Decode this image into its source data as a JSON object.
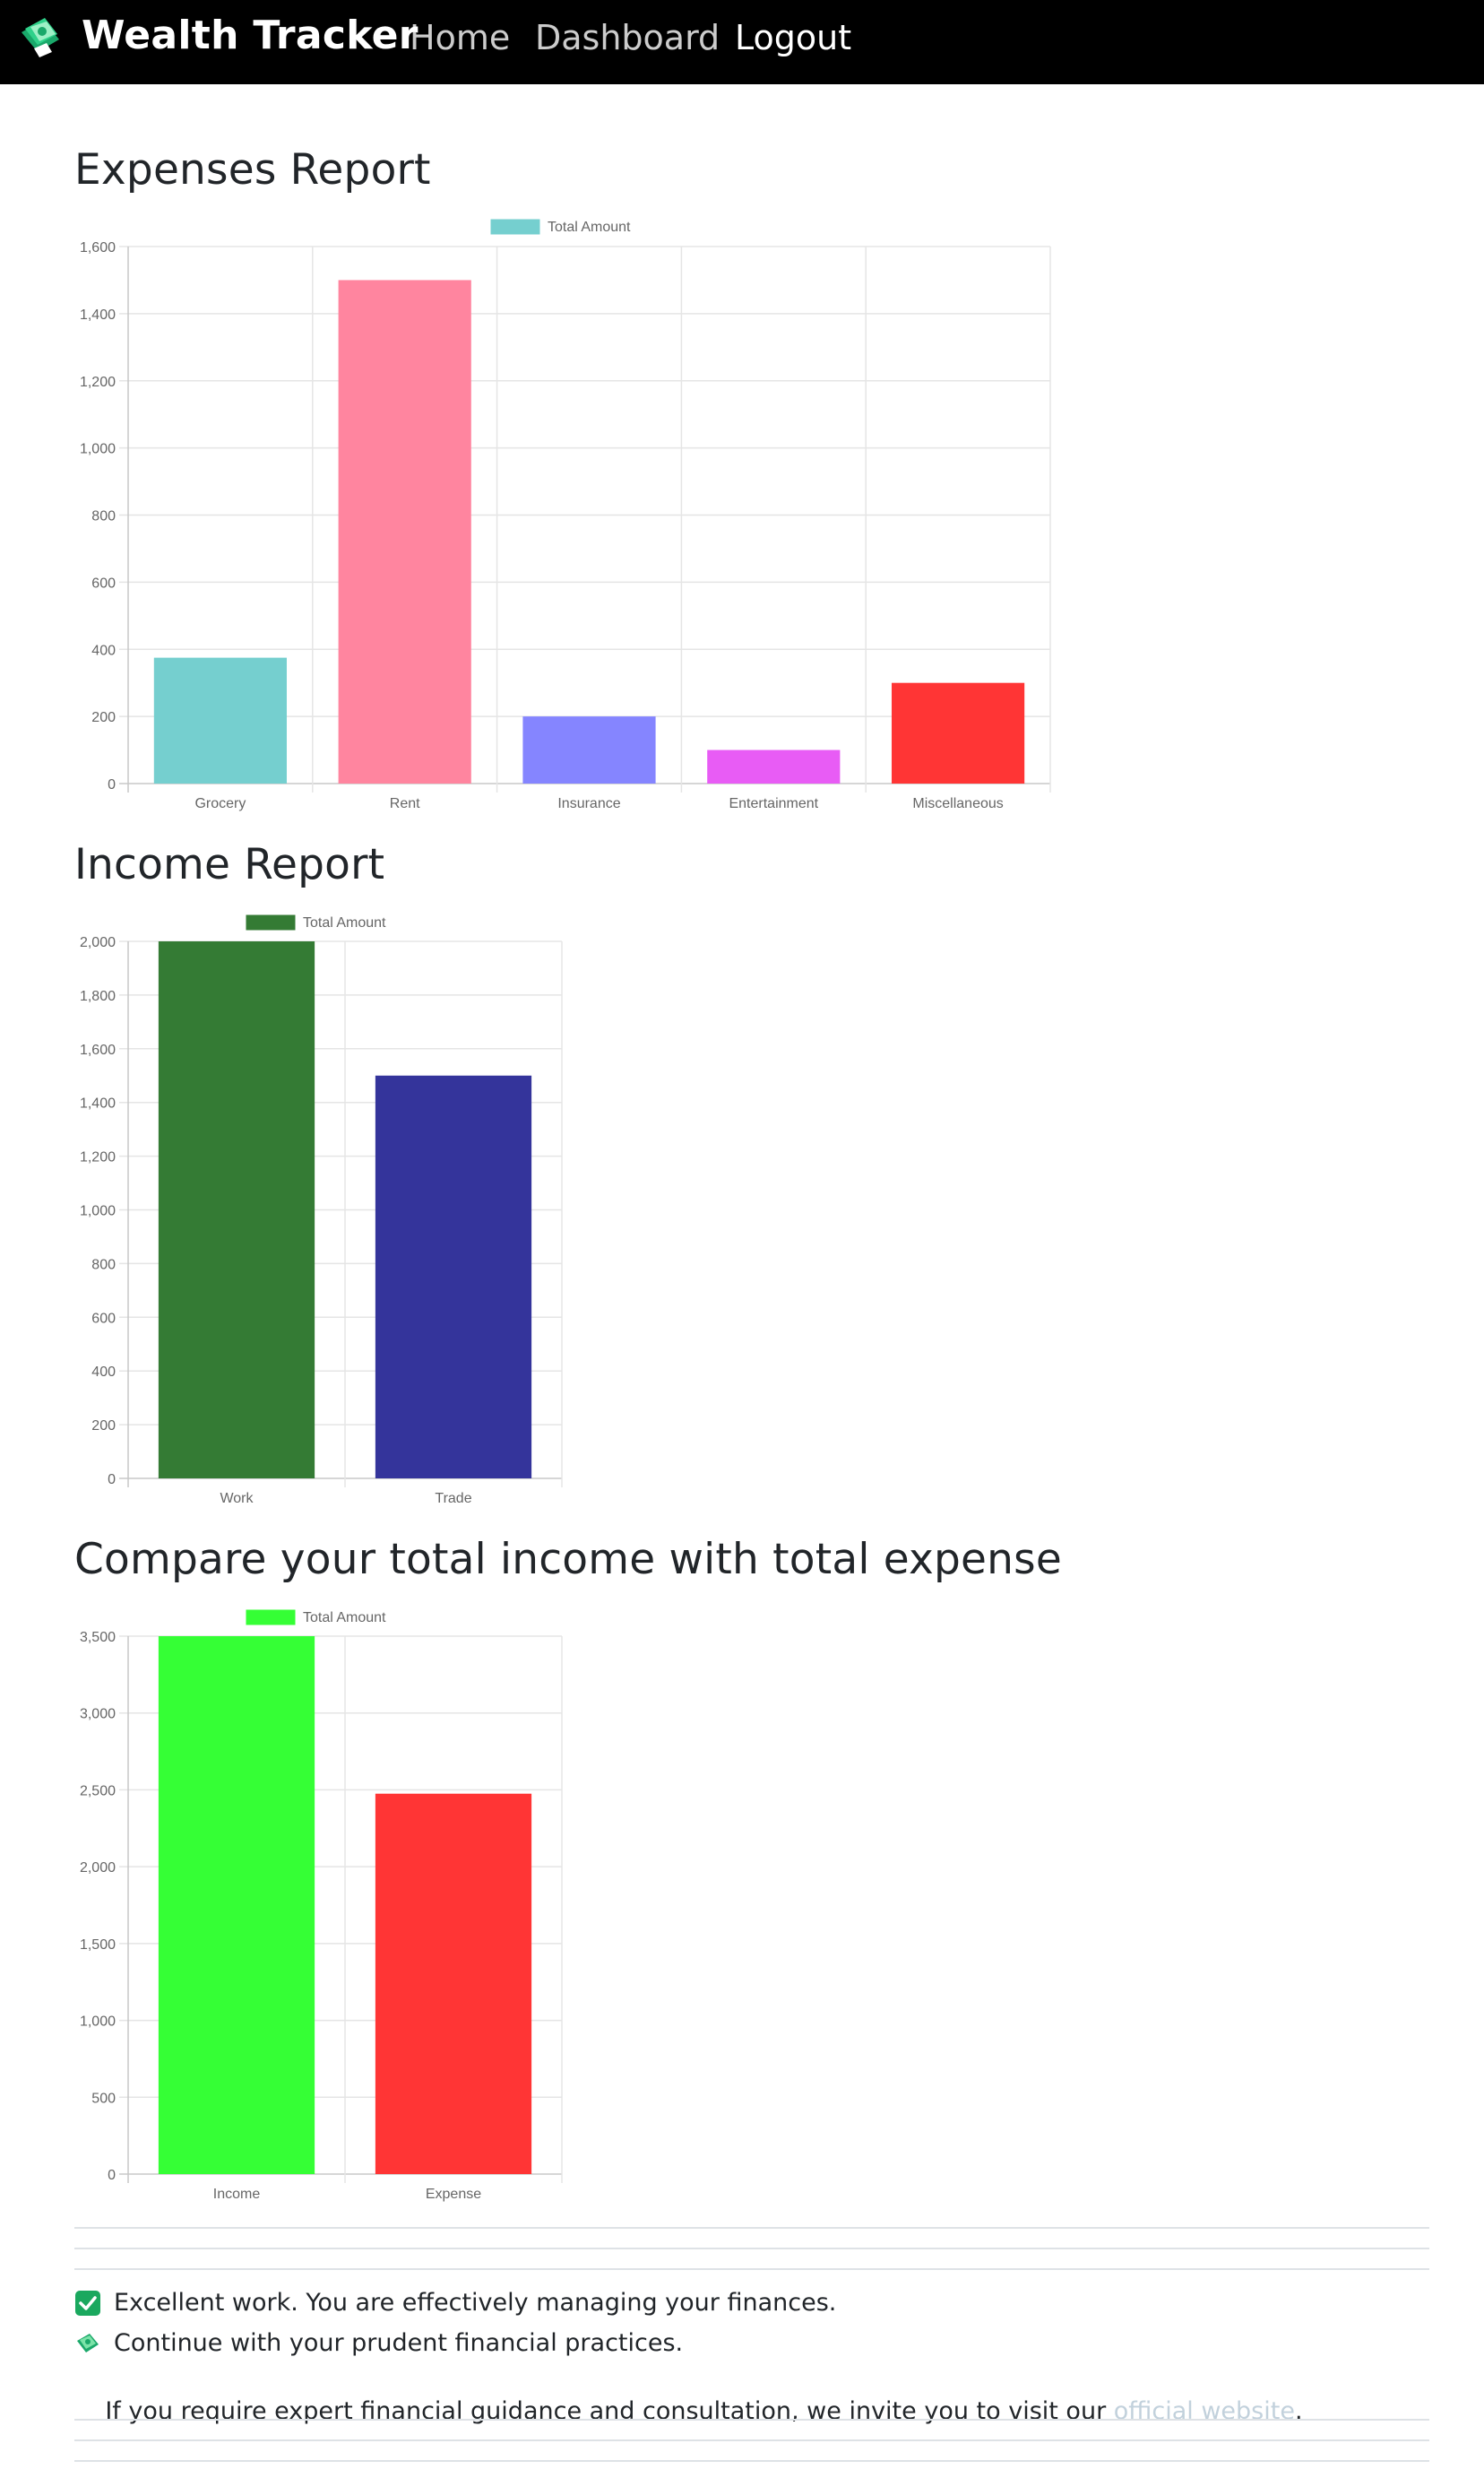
{
  "navbar": {
    "brand": "Wealth Tracker",
    "brand_icon": "money-icon",
    "links": [
      "Home",
      "Dashboard",
      "Logout"
    ]
  },
  "sections": {
    "expenses_title": "Expenses Report",
    "income_title": "Income Report",
    "compare_title": "Compare your total income with total expense"
  },
  "messages": {
    "excellent": "Excellent work. You are effectively managing your finances.",
    "continue": "Continue with your prudent financial practices.",
    "guidance_before": "If you require expert financial guidance and consultation, we invite you to visit our ",
    "guidance_link": "official website",
    "guidance_after": "."
  },
  "chart_data": [
    {
      "type": "bar",
      "categories": [
        "Grocery",
        "Rent",
        "Insurance",
        "Entertainment",
        "Miscellaneous"
      ],
      "series": [
        {
          "name": "Total Amount",
          "values": [
            375,
            1500,
            200,
            100,
            300
          ]
        }
      ],
      "colors": [
        "#75cfcf",
        "#ff859f",
        "#8585ff",
        "#e85cf5",
        "#ff3535"
      ],
      "legend_color": "#75cfcf",
      "yticks": [
        0,
        200,
        400,
        600,
        800,
        1000,
        1200,
        1400,
        1600
      ],
      "ylim": [
        0,
        1600
      ],
      "grid": true,
      "legend": "top-center"
    },
    {
      "type": "bar",
      "categories": [
        "Work",
        "Trade"
      ],
      "series": [
        {
          "name": "Total Amount",
          "values": [
            2000,
            1500
          ]
        }
      ],
      "colors": [
        "#347b34",
        "#34349b"
      ],
      "legend_color": "#347b34",
      "yticks": [
        0,
        200,
        400,
        600,
        800,
        1000,
        1200,
        1400,
        1600,
        1800,
        2000
      ],
      "ylim": [
        0,
        2000
      ],
      "grid": true,
      "legend": "top-center"
    },
    {
      "type": "bar",
      "categories": [
        "Income",
        "Expense"
      ],
      "series": [
        {
          "name": "Total Amount",
          "values": [
            3500,
            2475
          ]
        }
      ],
      "colors": [
        "#35ff35",
        "#ff3535"
      ],
      "legend_color": "#35ff35",
      "yticks": [
        0,
        500,
        1000,
        1500,
        2000,
        2500,
        3000,
        3500
      ],
      "ylim": [
        0,
        3500
      ],
      "grid": true,
      "legend": "top-center"
    }
  ]
}
